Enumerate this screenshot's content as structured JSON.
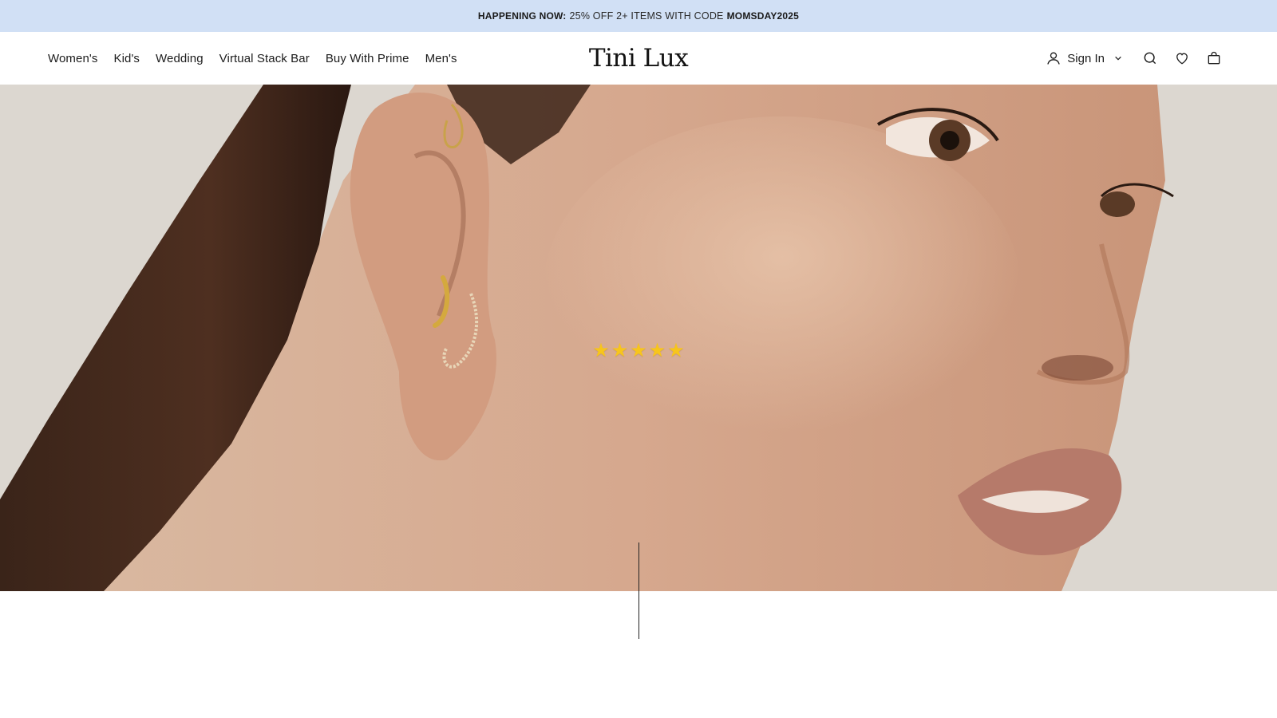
{
  "announcement": {
    "lead": "HAPPENING NOW:",
    "text": "25% OFF 2+ ITEMS WITH CODE",
    "code": "MOMSDAY2025"
  },
  "header": {
    "logo": "Tini Lux",
    "nav": [
      "Women's",
      "Kid's",
      "Wedding",
      "Virtual Stack Bar",
      "Buy With Prime",
      "Men's"
    ],
    "sign_in": "Sign In"
  },
  "hero": {
    "rating": {
      "value": 5,
      "max": 5
    },
    "star_color": "#f7c51c"
  },
  "colors": {
    "announcement_bg": "#d1e0f5",
    "text": "#1c1c1c"
  },
  "icons": [
    "user-icon",
    "chevron-down-icon",
    "search-icon",
    "heart-icon",
    "bag-icon",
    "star-icon"
  ]
}
